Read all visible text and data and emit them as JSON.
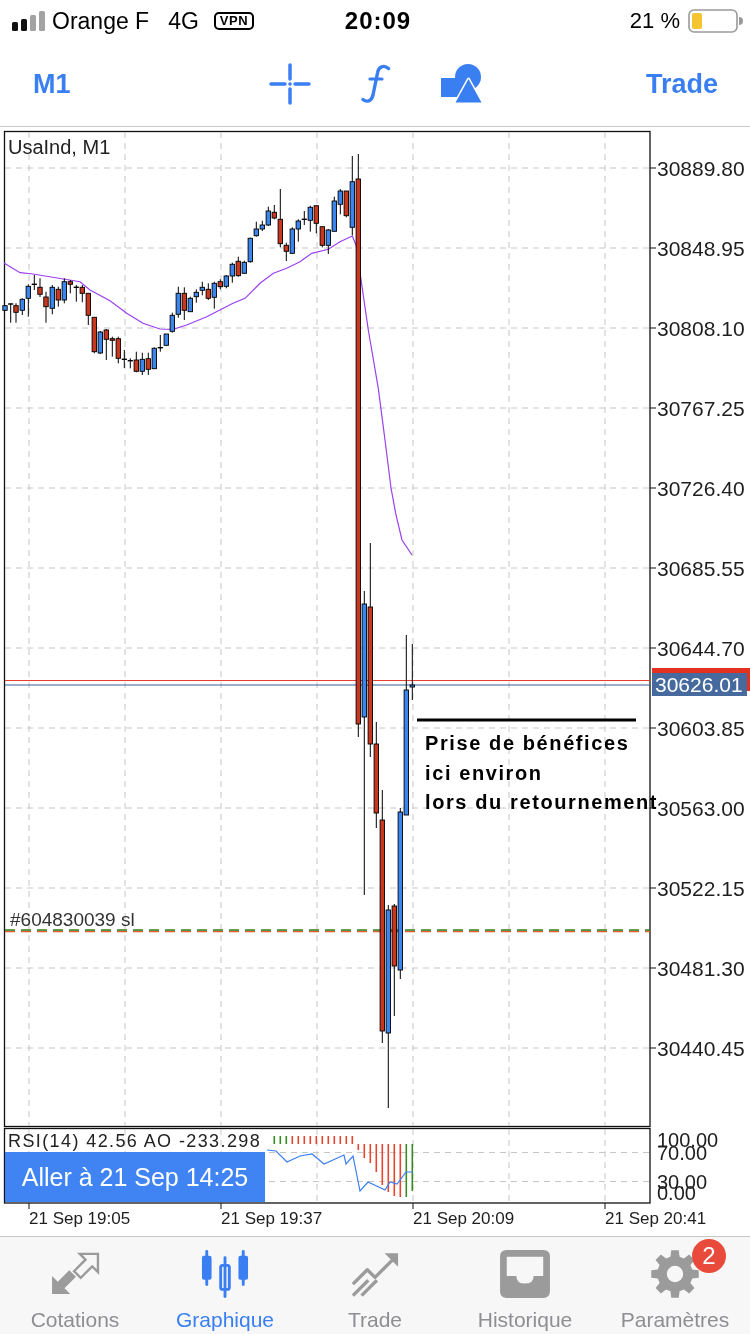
{
  "status_bar": {
    "carrier": "Orange F",
    "network": "4G",
    "vpn": "VPN",
    "time": "20:09",
    "battery": "21 %"
  },
  "toolbar": {
    "timeframe": "M1",
    "trade": "Trade"
  },
  "chart": {
    "symbol": "UsaInd, M1",
    "price_labels": [
      "30889.80",
      "30848.95",
      "30808.10",
      "30767.25",
      "30726.40",
      "30685.55",
      "30644.70",
      "30603.85",
      "30563.00",
      "30522.15",
      "30481.30",
      "30440.45"
    ],
    "current_price": "30626.01",
    "order_label": "#604830039 sl",
    "annotation": [
      "Prise de bénéfices",
      "ici environ",
      "lors du retournement"
    ],
    "indicator": {
      "legend": "RSI(14) 42.56 AO -233.298",
      "levels": [
        "100.00",
        "70.00",
        "30.00",
        "0.00"
      ]
    },
    "goto_button": "Aller à 21 Sep 14:25",
    "time_labels": [
      "21 Sep 19:05",
      "21 Sep 19:37",
      "21 Sep 20:09",
      "21 Sep 20:41"
    ]
  },
  "tabs": [
    {
      "label": "Cotations",
      "selected": false
    },
    {
      "label": "Graphique",
      "selected": true
    },
    {
      "label": "Trade",
      "selected": false
    },
    {
      "label": "Historique",
      "selected": false
    },
    {
      "label": "Paramètres",
      "selected": false,
      "badge": "2"
    }
  ]
}
